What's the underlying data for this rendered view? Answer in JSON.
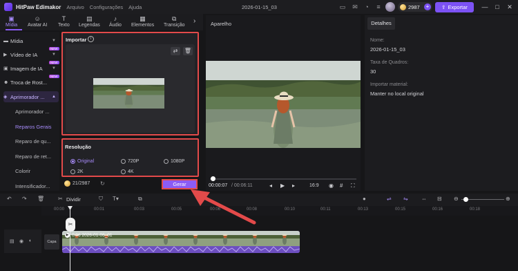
{
  "titlebar": {
    "app_name": "HitPaw Edimakor",
    "menu": [
      "Arquivo",
      "Configurações",
      "Ajuda"
    ],
    "project_title": "2026-01-15_03",
    "credits": "2987",
    "export_label": "Exportar"
  },
  "toolbar": {
    "tabs": [
      {
        "label": "Mídia",
        "icon": "media-icon"
      },
      {
        "label": "Avatar AI",
        "icon": "avatar-icon"
      },
      {
        "label": "Texto",
        "icon": "text-icon"
      },
      {
        "label": "Legendas",
        "icon": "subtitles-icon"
      },
      {
        "label": "Áudio",
        "icon": "audio-icon"
      },
      {
        "label": "Elementos",
        "icon": "elements-icon"
      },
      {
        "label": "Transição",
        "icon": "transition-icon"
      }
    ]
  },
  "sidebar": {
    "items": [
      {
        "label": "Mídia"
      },
      {
        "label": "Vídeo de IA",
        "badge": "NEW"
      },
      {
        "label": "Imagem de IA",
        "badge": "NEW"
      },
      {
        "label": "Troca de Rost...",
        "badge": "NEW"
      },
      {
        "label": "Aprimorador ..."
      }
    ],
    "subitems": [
      "Aprimorador ...",
      "Reparos Gerais",
      "Reparo de qu...",
      "Reparo de ret...",
      "Colorir",
      "Intensificador..."
    ]
  },
  "import": {
    "title": "Importar"
  },
  "resolution": {
    "title": "Resolução",
    "options": [
      "Original",
      "720P",
      "1080P",
      "2K",
      "4K"
    ],
    "selected": "Original"
  },
  "generate": {
    "credits": "21/2987",
    "button_label": "Gerar"
  },
  "player": {
    "label": "Aparelho",
    "time_current": "00:00:07",
    "time_total": "/ 00:06:11",
    "aspect": "16:9",
    "progress": 0.02
  },
  "details": {
    "tab": "Detalhes",
    "fields": [
      {
        "label": "Nome:",
        "value": "2026-01-15_03"
      },
      {
        "label": "Taxa de Quadros:",
        "value": "30"
      },
      {
        "label": "Importar material:",
        "value": "Manter no local original"
      }
    ]
  },
  "timeline": {
    "split_label": "Dividir",
    "ticks": [
      "00:00",
      "00:01",
      "00:03",
      "00:05",
      "00:06",
      "00:08",
      "00:10",
      "00:11",
      "00:13",
      "00:15",
      "00:16",
      "00:18"
    ],
    "cover_label": "Capa",
    "clip_label": "0:06 2026-01-06_01"
  },
  "colors": {
    "accent": "#8b5cf6",
    "highlight": "#e34a4a",
    "background": "#161618"
  }
}
